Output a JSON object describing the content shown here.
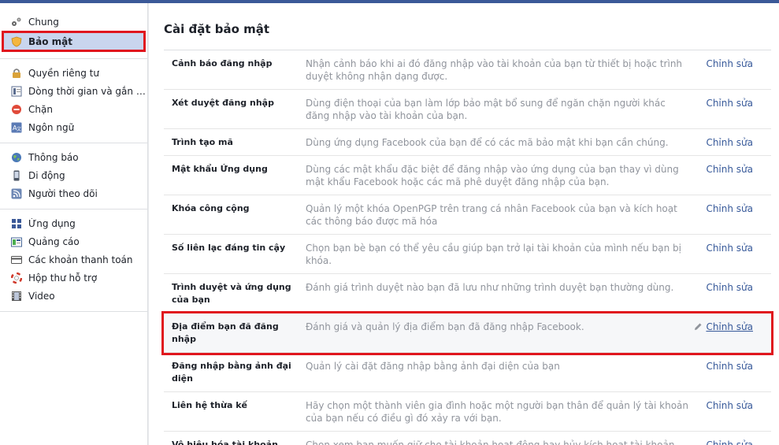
{
  "page_title": "Cài đặt bảo mật",
  "sidebar": {
    "groups": [
      [
        {
          "label": "Chung",
          "icon": "gears-icon"
        },
        {
          "label": "Bảo mật",
          "icon": "shield-icon",
          "active": true
        }
      ],
      [
        {
          "label": "Quyền riêng tư",
          "icon": "lock-icon"
        },
        {
          "label": "Dòng thời gian và gắn t...",
          "icon": "timeline-icon"
        },
        {
          "label": "Chặn",
          "icon": "block-icon"
        },
        {
          "label": "Ngôn ngữ",
          "icon": "language-icon"
        }
      ],
      [
        {
          "label": "Thông báo",
          "icon": "globe-icon"
        },
        {
          "label": "Di động",
          "icon": "mobile-icon"
        },
        {
          "label": "Người theo dõi",
          "icon": "rss-icon"
        }
      ],
      [
        {
          "label": "Ứng dụng",
          "icon": "apps-icon"
        },
        {
          "label": "Quảng cáo",
          "icon": "ads-icon"
        },
        {
          "label": "Các khoản thanh toán",
          "icon": "card-icon"
        },
        {
          "label": "Hộp thư hỗ trợ",
          "icon": "lifebuoy-icon"
        },
        {
          "label": "Video",
          "icon": "film-icon"
        }
      ]
    ]
  },
  "settings": {
    "edit_label": "Chỉnh sửa",
    "rows": [
      {
        "name": "Cảnh báo đăng nhập",
        "desc": "Nhận cảnh báo khi ai đó đăng nhập vào tài khoản của bạn từ thiết bị hoặc trình duyệt không nhận dạng được."
      },
      {
        "name": "Xét duyệt đăng nhập",
        "desc": "Dùng điện thoại của bạn làm lớp bảo mật bổ sung để ngăn chặn người khác đăng nhập vào tài khoản của bạn."
      },
      {
        "name": "Trình tạo mã",
        "desc": "Dùng ứng dụng Facebook của bạn để có các mã bảo mật khi bạn cần chúng."
      },
      {
        "name": "Mật khẩu Ứng dụng",
        "desc": "Dùng các mật khẩu đặc biệt để đăng nhập vào ứng dụng của bạn thay vì dùng mật khẩu Facebook hoặc các mã phê duyệt đăng nhập của bạn."
      },
      {
        "name": "Khóa công cộng",
        "desc": "Quản lý một khóa OpenPGP trên trang cá nhân Facebook của bạn và kích hoạt các thông báo được mã hóa"
      },
      {
        "name": "Số liên lạc đáng tin cậy",
        "desc": "Chọn bạn bè bạn có thể yêu cầu giúp bạn trở lại tài khoản của mình nếu bạn bị khóa."
      },
      {
        "name": "Trình duyệt và ứng dụng của bạn",
        "desc": "Đánh giá trình duyệt nào bạn đã lưu như những trình duyệt bạn thường dùng."
      },
      {
        "name": "Địa điểm bạn đã đăng nhập",
        "desc": "Đánh giá và quản lý địa điểm bạn đã đăng nhập Facebook.",
        "highlight": true
      },
      {
        "name": "Đăng nhập bằng ảnh đại diện",
        "desc": "Quản lý cài đặt đăng nhập bằng ảnh đại diện của bạn"
      },
      {
        "name": "Liên hệ thừa kế",
        "desc": "Hãy chọn một thành viên gia đình hoặc một người bạn thân để quản lý tài khoản của bạn nếu có điều gì đó xảy ra với bạn."
      },
      {
        "name": "Vô hiệu hóa tài khoản",
        "desc": "Chọn xem bạn muốn giữ cho tài khoản hoạt động hay hủy kích hoạt tài khoản."
      }
    ]
  },
  "colors": {
    "link": "#365899",
    "highlight_border": "#e0161e",
    "brand": "#3b5998"
  }
}
